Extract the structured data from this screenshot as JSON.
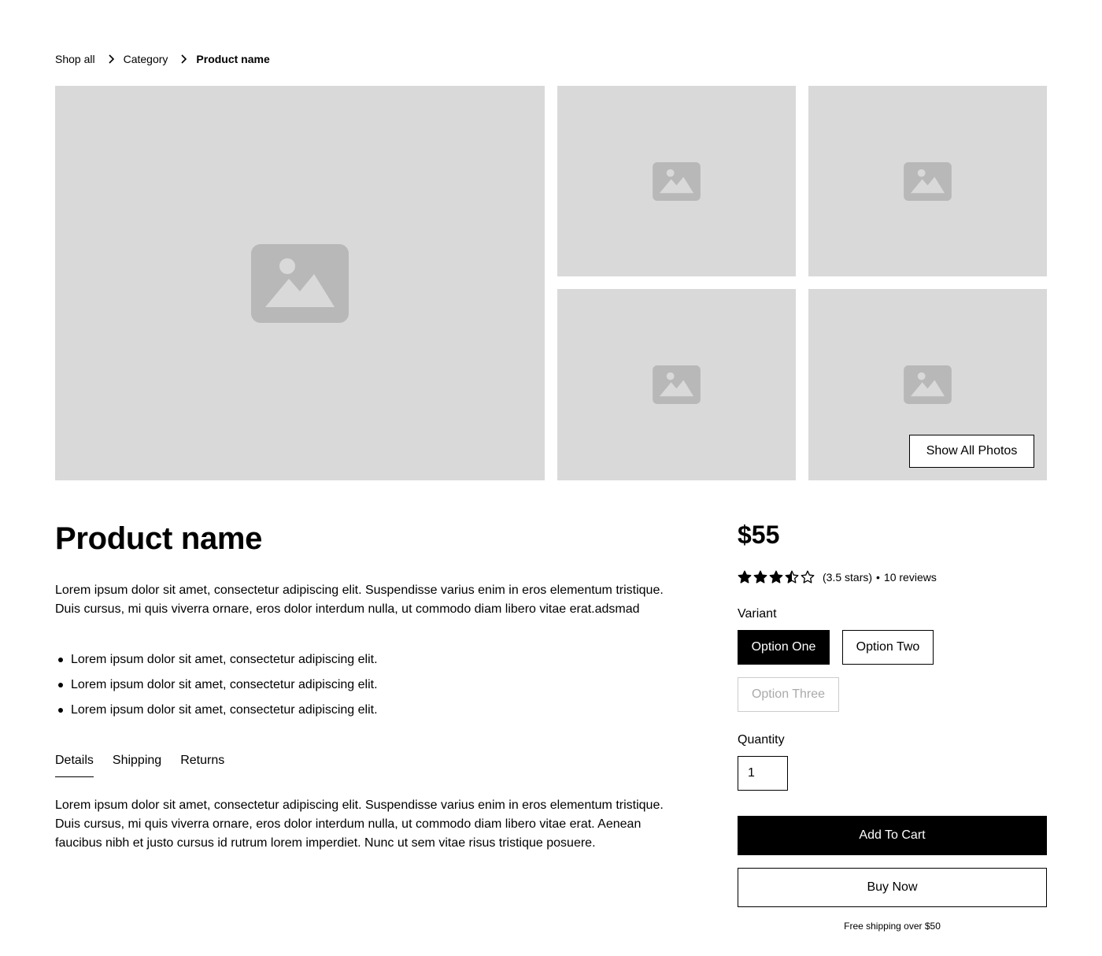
{
  "breadcrumb": {
    "items": [
      "Shop all",
      "Category",
      "Product name"
    ]
  },
  "gallery": {
    "show_all_label": "Show All Photos"
  },
  "product": {
    "title": "Product name",
    "description": "Lorem ipsum dolor sit amet, consectetur adipiscing elit. Suspendisse varius enim in eros elementum tristique. Duis cursus, mi quis viverra ornare, eros dolor interdum nulla, ut commodo diam libero vitae erat.adsmad",
    "bullets": [
      "Lorem ipsum dolor sit amet, consectetur adipiscing elit.",
      "Lorem ipsum dolor sit amet, consectetur adipiscing elit.",
      "Lorem ipsum dolor sit amet, consectetur adipiscing elit."
    ],
    "price": "$55",
    "rating": {
      "value": 3.5,
      "max": 5,
      "text": "(3.5 stars)",
      "separator": "•",
      "reviews": "10 reviews"
    }
  },
  "tabs": {
    "items": [
      "Details",
      "Shipping",
      "Returns"
    ],
    "active": "Details",
    "content": "Lorem ipsum dolor sit amet, consectetur adipiscing elit. Suspendisse varius enim in eros elementum tristique. Duis cursus, mi quis viverra ornare, eros dolor interdum nulla, ut commodo diam libero vitae erat. Aenean faucibus nibh et justo cursus id rutrum lorem imperdiet. Nunc ut sem vitae risus tristique posuere."
  },
  "purchase": {
    "variant_label": "Variant",
    "variants": [
      {
        "label": "Option One",
        "state": "selected"
      },
      {
        "label": "Option Two",
        "state": "default"
      },
      {
        "label": "Option Three",
        "state": "disabled"
      }
    ],
    "quantity_label": "Quantity",
    "quantity_value": "1",
    "add_to_cart_label": "Add To Cart",
    "buy_now_label": "Buy Now",
    "shipping_note": "Free shipping over $50"
  },
  "icons": {
    "breadcrumb_separator": "chevron-right-icon",
    "image_placeholder": "image-placeholder-icon",
    "star": "star-icon"
  },
  "colors": {
    "placeholder_bg": "#d9d9d9",
    "placeholder_icon": "#b8b8b8",
    "primary": "#000000",
    "disabled": "#aaaaaa"
  }
}
